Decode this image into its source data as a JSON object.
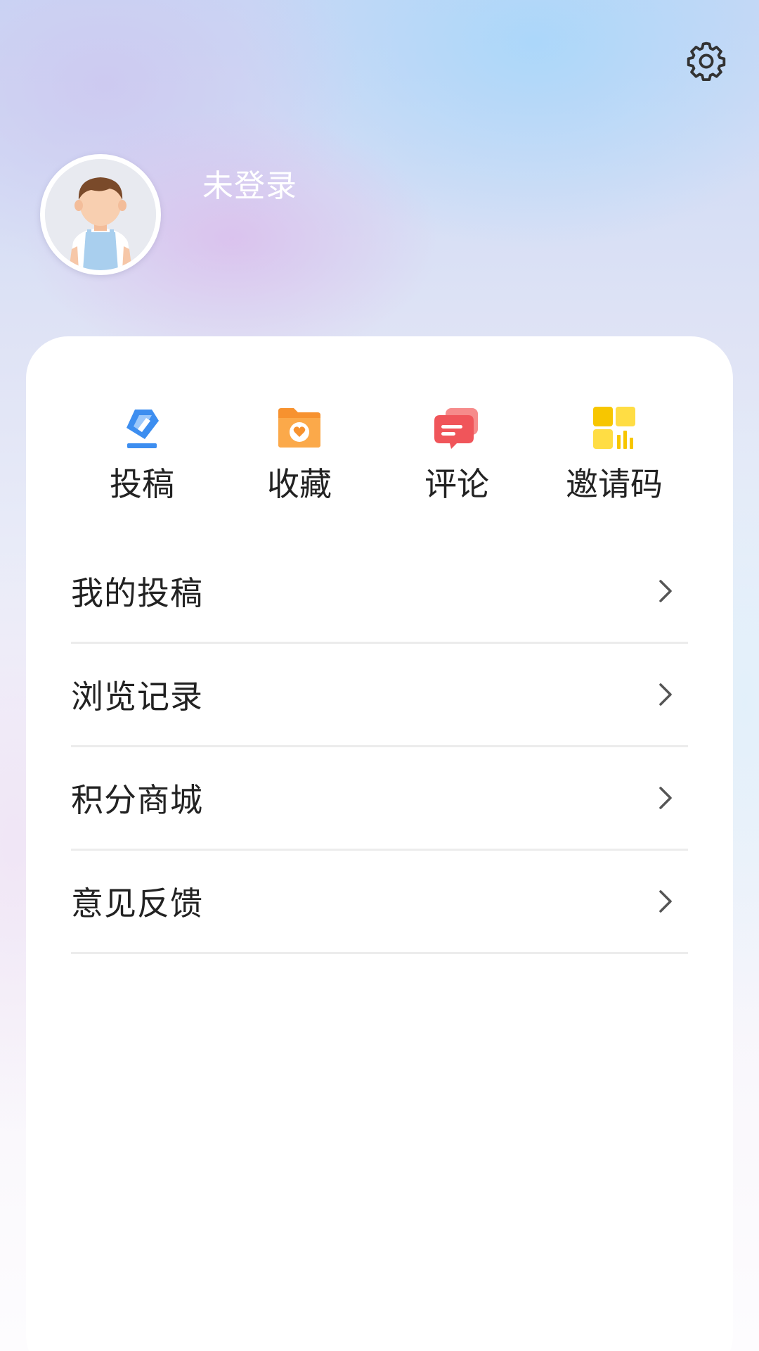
{
  "header": {
    "settings_icon": "gear-icon",
    "avatar_icon": "default-user-avatar",
    "login_status": "未登录"
  },
  "quick_actions": [
    {
      "label": "投稿",
      "icon": "submit-pen-icon",
      "color": "#3d8ef0"
    },
    {
      "label": "收藏",
      "icon": "heart-folder-icon",
      "color": "#f7922f"
    },
    {
      "label": "评论",
      "icon": "comment-bubble-icon",
      "color": "#f0555a"
    },
    {
      "label": "邀请码",
      "icon": "invite-code-icon",
      "color": "#f7c600"
    }
  ],
  "menu": [
    {
      "label": "我的投稿",
      "icon": "chevron-right-icon"
    },
    {
      "label": "浏览记录",
      "icon": "chevron-right-icon"
    },
    {
      "label": "积分商城",
      "icon": "chevron-right-icon"
    },
    {
      "label": "意见反馈",
      "icon": "chevron-right-icon"
    }
  ]
}
